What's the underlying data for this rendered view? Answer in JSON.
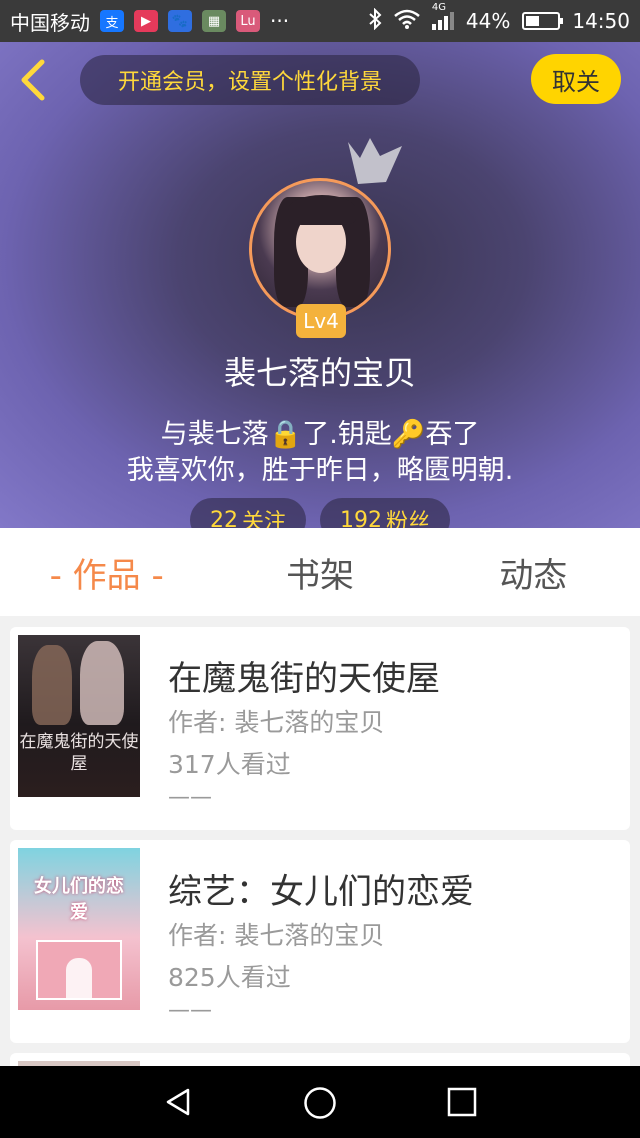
{
  "status_bar": {
    "carrier": "中国移动",
    "network": "4G",
    "battery_percent": "44%",
    "battery_level": 0.44,
    "time": "14:50",
    "more": "···"
  },
  "header": {
    "vip_prompt": "开通会员，设置个性化背景",
    "close_label": "取关",
    "level": "Lv4",
    "username": "裴七落的宝贝",
    "bio_line1": "与裴七落🔒了.钥匙🔑吞了",
    "bio_line2": "我喜欢你，胜于昨日，略匮明朝.",
    "following_count": "22",
    "following_label": "关注",
    "fans_count": "192",
    "fans_label": "粉丝"
  },
  "tabs": [
    {
      "label": "- 作品 -"
    },
    {
      "label": "书架"
    },
    {
      "label": "动态"
    }
  ],
  "works": [
    {
      "title": "在魔鬼街的天使屋",
      "author": "作者: 裴七落的宝贝",
      "views": "317人看过",
      "extra": "——",
      "cover_text": "在魔鬼街的天使屋"
    },
    {
      "title": "综艺：女儿们的恋爱",
      "author": "作者: 裴七落的宝贝",
      "views": "825人看过",
      "extra": "——",
      "cover_text": "女儿们的恋爱"
    }
  ],
  "colors": {
    "accent": "#f5894a",
    "gold": "#ffd83b",
    "close_button": "#ffd400",
    "header_purple": "#8278c8"
  }
}
